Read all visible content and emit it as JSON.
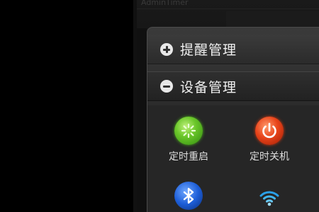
{
  "window": {
    "title": "AdminTimer"
  },
  "sections": [
    {
      "label": "提醒管理",
      "state": "collapsed",
      "icon": "plus-circle-icon"
    },
    {
      "label": "设备管理",
      "state": "expanded",
      "icon": "minus-circle-icon"
    }
  ],
  "device_tools": [
    {
      "label": "定时重启",
      "icon": "restart-icon",
      "color": "#5cbf22"
    },
    {
      "label": "定时关机",
      "icon": "power-icon",
      "color": "#e8441a"
    },
    {
      "label": "",
      "icon": "bluetooth-icon",
      "color": "#1d5ed8"
    },
    {
      "label": "",
      "icon": "wifi-icon",
      "color": "#2aa0e8"
    }
  ]
}
